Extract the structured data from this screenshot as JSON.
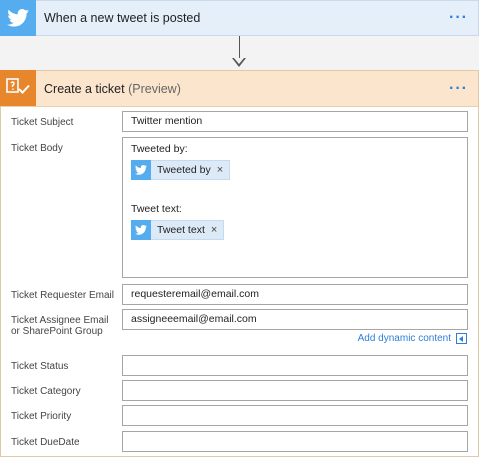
{
  "trigger": {
    "title": "When a new tweet is posted",
    "icon": "twitter-icon",
    "more": "···"
  },
  "action": {
    "title": "Create a ticket",
    "preview": "(Preview)",
    "icon": "ticket-icon",
    "more": "···"
  },
  "fields": {
    "subject_label": "Ticket Subject",
    "subject_value": "Twitter mention",
    "body_label": "Ticket Body",
    "body_line1": "Tweeted by:",
    "body_token1": "Tweeted by",
    "body_line2": "Tweet text:",
    "body_token2": "Tweet text",
    "requester_label": "Ticket Requester Email",
    "requester_value": "requesteremail@email.com",
    "assignee_label_1": "Ticket Assignee Email",
    "assignee_label_2": "or SharePoint Group",
    "assignee_value": "assigneeemail@email.com",
    "add_dynamic": "Add dynamic content",
    "status_label": "Ticket Status",
    "status_value": "",
    "category_label": "Ticket Category",
    "category_value": "",
    "priority_label": "Ticket Priority",
    "priority_value": "",
    "duedate_label": "Ticket DueDate",
    "duedate_value": ""
  },
  "colors": {
    "twitter": "#55acee",
    "action_accent": "#e8862b",
    "link": "#2f7ed8"
  }
}
